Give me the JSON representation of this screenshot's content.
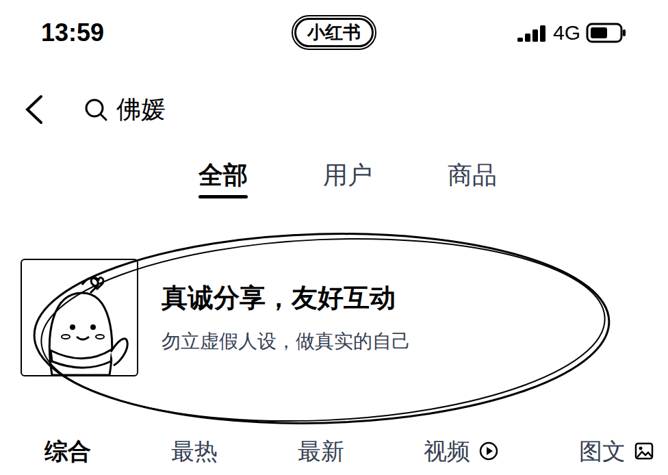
{
  "status_bar": {
    "time": "13:59",
    "logo": "小红书",
    "network": "4G",
    "signal": {
      "level": 1
    },
    "battery": {
      "level": 0.6
    }
  },
  "search": {
    "query": "佛媛"
  },
  "tabs": [
    {
      "label": "全部",
      "selected": true
    },
    {
      "label": "用户",
      "selected": false
    },
    {
      "label": "商品",
      "selected": false
    }
  ],
  "banner": {
    "title": "真诚分享，友好互动",
    "subtitle": "勿立虚假人设，做真实的自己"
  },
  "filters": [
    {
      "label": "综合",
      "kind": "plain",
      "selected": true
    },
    {
      "label": "最热",
      "kind": "plain",
      "selected": false
    },
    {
      "label": "最新",
      "kind": "plain",
      "selected": false
    },
    {
      "label": "视频",
      "kind": "video",
      "selected": false
    },
    {
      "label": "图文",
      "kind": "image",
      "selected": false
    }
  ]
}
